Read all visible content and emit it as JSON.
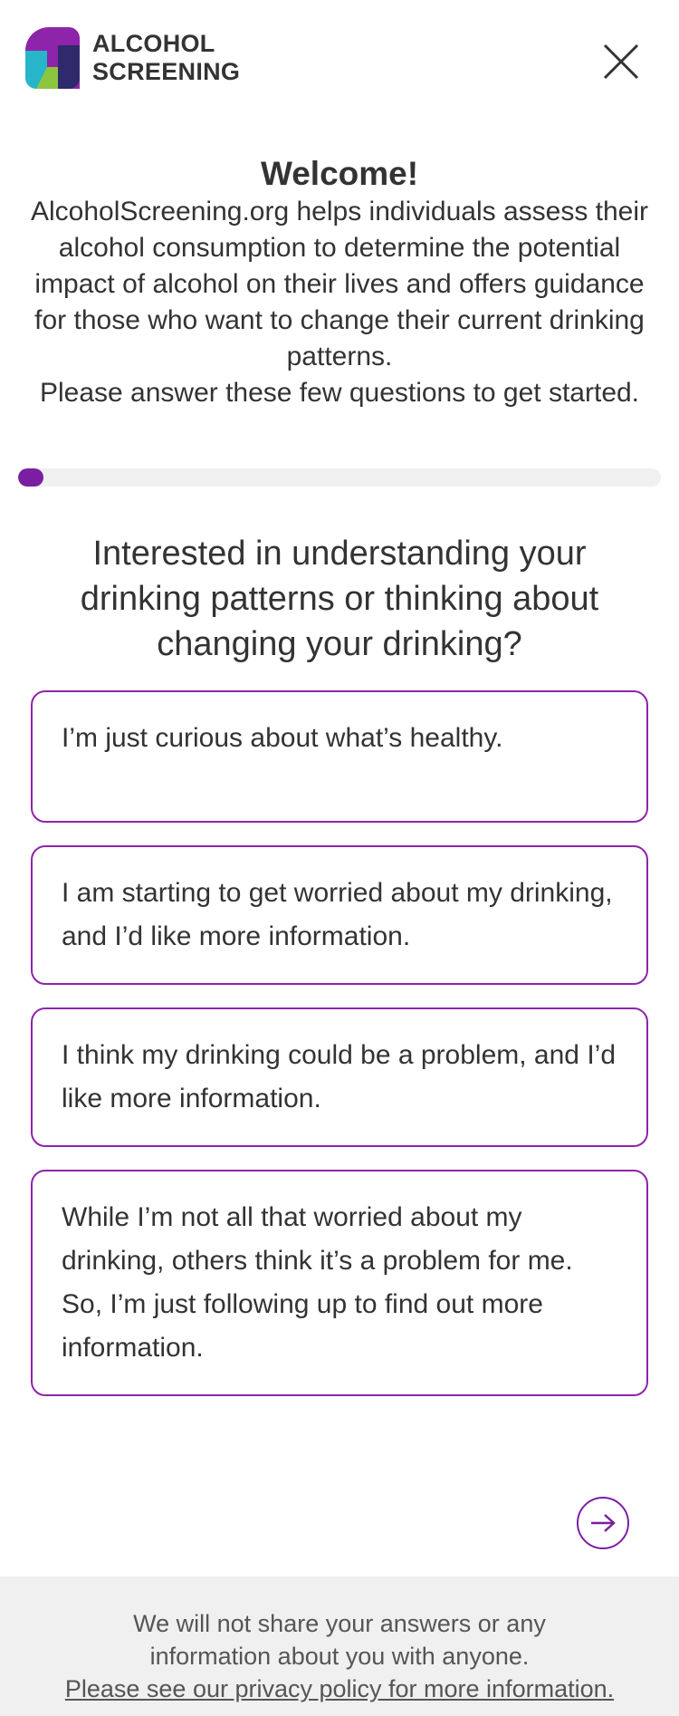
{
  "header": {
    "logo_line1": "ALCOHOL",
    "logo_line2": "SCREENING",
    "close_icon": "close-icon"
  },
  "welcome": {
    "title": "Welcome!",
    "body": "AlcoholScreening.org helps individuals assess their alcohol consumption to determine the potential impact of alcohol on their lives and offers guidance for those who want to change their current drinking patterns.",
    "prompt": "Please answer these few questions to get started."
  },
  "progress": {
    "fraction": 0.04,
    "color": "#7b1fa2"
  },
  "question": {
    "text": "Interested in understanding your drinking patterns or thinking about changing your drinking?"
  },
  "options": [
    {
      "label": "I’m just curious about what’s healthy."
    },
    {
      "label": "I am starting to get worried about my drinking, and I’d like more information."
    },
    {
      "label": "I think my drinking could be a problem, and I’d like more information."
    },
    {
      "label": "While I’m not all that worried about my drinking, others think it’s a problem for me. So, I’m just following up to find out more information."
    }
  ],
  "next_icon": "arrow-right-icon",
  "footer": {
    "line1": "We will not share your answers or any",
    "line2": "information about you with anyone.",
    "link": "Please see our privacy policy for more information."
  },
  "colors": {
    "accent": "#7b1fa2",
    "option_border": "#8e24aa",
    "footer_bg": "#f0f0f0",
    "logo_purple": "#8e24aa",
    "logo_cyan": "#26b5c9",
    "logo_navy": "#2e2a6b",
    "logo_green": "#8cc63f"
  }
}
